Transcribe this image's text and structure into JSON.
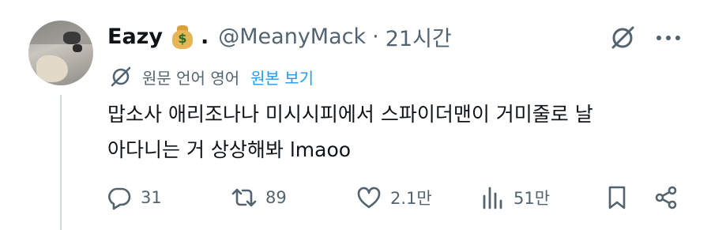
{
  "tweet": {
    "author_name": "Eazy",
    "author_emoji": "money-bag-emoji",
    "name_suffix": ".",
    "handle": "@MeanyMack",
    "separator": "·",
    "time": "21시간",
    "translation_meta": "원문 언어 영어",
    "translation_link": "원본 보기",
    "text_lines": [
      "맙소사 애리조나나 미시시피에서 스파이더맨이 거미줄로 날",
      "아다니는 거 상상해봐 lmaoo"
    ]
  },
  "actions": {
    "replies": "31",
    "retweets": "89",
    "likes": "2.1만",
    "views": "51만"
  },
  "icons": {
    "grok": "grok-icon",
    "more": "more-dots-icon",
    "translate": "translate-icon",
    "reply": "reply-icon",
    "retweet": "retweet-icon",
    "like": "heart-icon",
    "views": "views-chart-icon",
    "bookmark": "bookmark-icon",
    "share": "share-icon"
  },
  "colors": {
    "text": "#0f1419",
    "secondary": "#536471",
    "link": "#1d9bf0",
    "thread_line": "#cfd9de"
  }
}
